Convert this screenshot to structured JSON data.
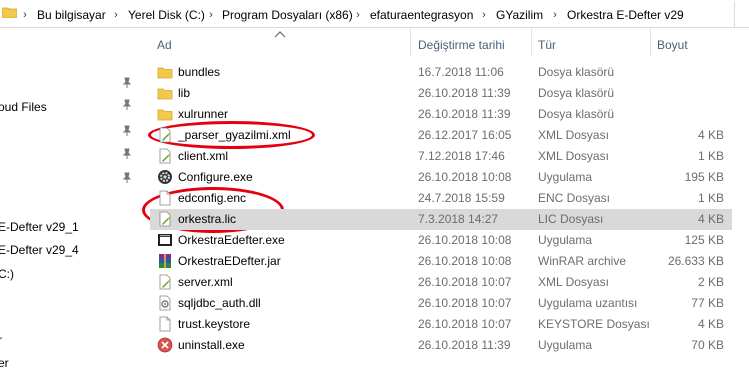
{
  "breadcrumb": [
    "Bu bilgisayar",
    "Yerel Disk (C:)",
    "Program Dosyaları (x86)",
    "efaturaentegrasyon",
    "GYazilim",
    "Orkestra E-Defter v29"
  ],
  "nav": {
    "items": [
      "oud Files",
      "E-Defter v29_1",
      "E-Defter v29_4",
      "C:)",
      "r",
      "er"
    ]
  },
  "columns": {
    "name": "Ad",
    "date": "Değiştirme tarihi",
    "type": "Tür",
    "size": "Boyut"
  },
  "files": [
    {
      "name": "bundles",
      "date": "16.7.2018 11:06",
      "type": "Dosya klasörü",
      "size": "",
      "icon": "folder-icon"
    },
    {
      "name": "lib",
      "date": "26.10.2018 11:39",
      "type": "Dosya klasörü",
      "size": "",
      "icon": "folder-icon"
    },
    {
      "name": "xulrunner",
      "date": "26.10.2018 11:39",
      "type": "Dosya klasörü",
      "size": "",
      "icon": "folder-icon"
    },
    {
      "name": "_parser_gyazilmi.xml",
      "date": "26.12.2017 16:05",
      "type": "XML Dosyası",
      "size": "4 KB",
      "icon": "xml-file-icon"
    },
    {
      "name": "client.xml",
      "date": "7.12.2018 17:46",
      "type": "XML Dosyası",
      "size": "1 KB",
      "icon": "xml-file-icon"
    },
    {
      "name": "Configure.exe",
      "date": "26.10.2018 10:08",
      "type": "Uygulama",
      "size": "195 KB",
      "icon": "gear-exe-icon"
    },
    {
      "name": "edconfig.enc",
      "date": "24.7.2018 15:59",
      "type": "ENC Dosyası",
      "size": "1 KB",
      "icon": "blank-file-icon"
    },
    {
      "name": "orkestra.lic",
      "date": "7.3.2018 14:27",
      "type": "LIC Dosyası",
      "size": "4 KB",
      "icon": "lic-file-icon"
    },
    {
      "name": "OrkestraEdefter.exe",
      "date": "26.10.2018 10:08",
      "type": "Uygulama",
      "size": "125 KB",
      "icon": "app-exe-icon"
    },
    {
      "name": "OrkestraEDefter.jar",
      "date": "26.10.2018 10:08",
      "type": "WinRAR archive",
      "size": "26.633 KB",
      "icon": "winrar-icon"
    },
    {
      "name": "server.xml",
      "date": "26.10.2018 10:07",
      "type": "XML Dosyası",
      "size": "2 KB",
      "icon": "xml-file-icon"
    },
    {
      "name": "sqljdbc_auth.dll",
      "date": "26.10.2018 10:07",
      "type": "Uygulama uzantısı",
      "size": "77 KB",
      "icon": "dll-file-icon"
    },
    {
      "name": "trust.keystore",
      "date": "26.10.2018 10:07",
      "type": "KEYSTORE Dosyası",
      "size": "4 KB",
      "icon": "blank-file-icon"
    },
    {
      "name": "uninstall.exe",
      "date": "26.10.2018 11:39",
      "type": "Uygulama",
      "size": "70 KB",
      "icon": "uninstall-exe-icon"
    }
  ],
  "colors": {
    "highlight_oval": "#e4000f",
    "selected_row": "#d9d9d9",
    "folder": "#f2c94c",
    "header_text": "#4c607a"
  }
}
